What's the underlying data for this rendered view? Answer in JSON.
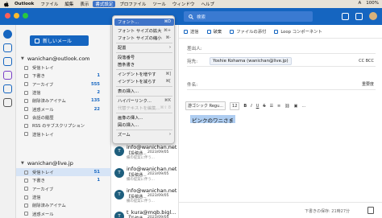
{
  "menubar": {
    "items": [
      "Outlook",
      "ファイル",
      "編集",
      "表示",
      "書式設定",
      "プロファイル",
      "ツール",
      "ウィンドウ",
      "ヘルプ"
    ],
    "active_index": 4,
    "right": [
      "A",
      "100%"
    ]
  },
  "topbar": {
    "search_placeholder": "検索"
  },
  "folders": {
    "new_mail": "新しいメール",
    "account1": {
      "name": "wanichan@outlook.com",
      "items": [
        {
          "label": "受信トレイ",
          "count": "",
          "selected": false
        },
        {
          "label": "下書き",
          "count": "1",
          "selected": false
        },
        {
          "label": "アーカイブ",
          "count": "555",
          "selected": false
        },
        {
          "label": "送信",
          "count": "2",
          "selected": false
        },
        {
          "label": "削除済みアイテム",
          "count": "135",
          "selected": false
        },
        {
          "label": "迷惑メール",
          "count": "22",
          "selected": false
        },
        {
          "label": "会話の履歴",
          "count": "",
          "selected": false
        },
        {
          "label": "RSS のサブスクリプション",
          "count": "",
          "selected": false
        },
        {
          "label": "送信トレイ",
          "count": "",
          "selected": false
        }
      ]
    },
    "account2": {
      "name": "wanichan@live.jp",
      "items": [
        {
          "label": "受信トレイ",
          "count": "51",
          "selected": true
        },
        {
          "label": "下書き",
          "count": "1",
          "selected": false
        },
        {
          "label": "アーカイブ",
          "count": "",
          "selected": false
        },
        {
          "label": "送信",
          "count": "",
          "selected": false
        },
        {
          "label": "削除済みアイテム",
          "count": "",
          "selected": false
        },
        {
          "label": "迷惑メール",
          "count": "",
          "selected": false
        }
      ]
    }
  },
  "messages": [
    {
      "from": "info@wanichan.net",
      "subject": "【投稿通...",
      "date": "2023/09/05",
      "preview": "備の提案に伴う..."
    },
    {
      "from": "info@wanichan.net",
      "subject": "【投稿通...",
      "date": "2023/09/05",
      "preview": "備の提案に伴う..."
    },
    {
      "from": "info@wanichan.net",
      "subject": "【投稿通...",
      "date": "2023/09/05",
      "preview": "備の提案に伴う..."
    },
    {
      "from": "t_kura@mqb.bigl...",
      "subject": "【投稿通...",
      "date": "2023/09/04",
      "preview": "備の提案に伴う..."
    }
  ],
  "format_menu": [
    {
      "label": "フォント...",
      "shortcut": "⌘D",
      "style": "hl"
    },
    {
      "label": "フォント サイズの拡大",
      "shortcut": "⌘+",
      "style": ""
    },
    {
      "label": "フォント サイズの縮小",
      "shortcut": "⌘-",
      "style": ""
    },
    {
      "label": "配置",
      "shortcut": "",
      "style": "arrow"
    },
    {
      "label": "段落番号",
      "shortcut": "",
      "style": ""
    },
    {
      "label": "箇条書き",
      "shortcut": "",
      "style": ""
    },
    {
      "label": "インデントを増やす",
      "shortcut": "⌘]",
      "style": ""
    },
    {
      "label": "インデントを減らす",
      "shortcut": "⌘[",
      "style": ""
    },
    {
      "label": "表の挿入...",
      "shortcut": "",
      "style": ""
    },
    {
      "label": "ハイパーリンク...",
      "shortcut": "⌘K",
      "style": ""
    },
    {
      "label": "代替テキストを編集...",
      "shortcut": "⌘⇧ 8",
      "style": "dim"
    },
    {
      "label": "画像の挿入...",
      "shortcut": "",
      "style": ""
    },
    {
      "label": "図の挿入...",
      "shortcut": "",
      "style": ""
    },
    {
      "label": "ズーム",
      "shortcut": "",
      "style": "arrow"
    }
  ],
  "compose": {
    "toolbar": [
      "送信",
      "破棄",
      "ファイルの添付",
      "Loop コンポーネント"
    ],
    "from_label": "差出人:",
    "from_value": "",
    "to_label": "宛先:",
    "to_value": "Yoshie Kohama (wanichan@live.jp)",
    "cc_bcc": "CC  BCC",
    "subject_label": "件名:",
    "priority": "重要度",
    "font_name": "游ゴシック Regu...",
    "font_size": "12",
    "body_text": "ピンクのワニさま",
    "draft_status": "下書きの保存: 21時27分"
  }
}
